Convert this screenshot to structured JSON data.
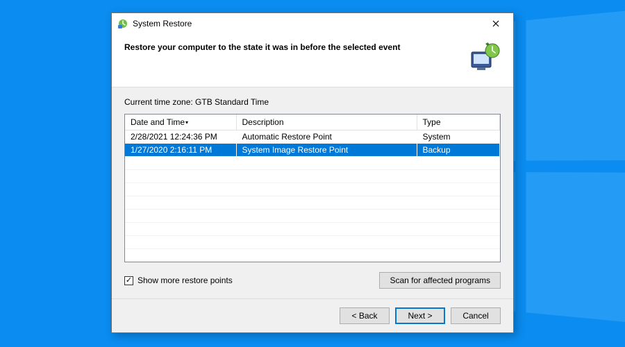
{
  "titlebar": {
    "title": "System Restore"
  },
  "header": {
    "heading": "Restore your computer to the state it was in before the selected event"
  },
  "body": {
    "timezone_label": "Current time zone: GTB Standard Time",
    "columns": {
      "datetime": "Date and Time",
      "description": "Description",
      "type": "Type"
    },
    "rows": [
      {
        "datetime": "2/28/2021 12:24:36 PM",
        "description": "Automatic Restore Point",
        "type": "System",
        "selected": false
      },
      {
        "datetime": "1/27/2020 2:16:11 PM",
        "description": "System Image Restore Point",
        "type": "Backup",
        "selected": true
      }
    ],
    "checkbox": {
      "label": "Show more restore points",
      "checked": true
    },
    "scan_button": "Scan for affected programs"
  },
  "footer": {
    "back": "< Back",
    "next": "Next >",
    "cancel": "Cancel"
  }
}
